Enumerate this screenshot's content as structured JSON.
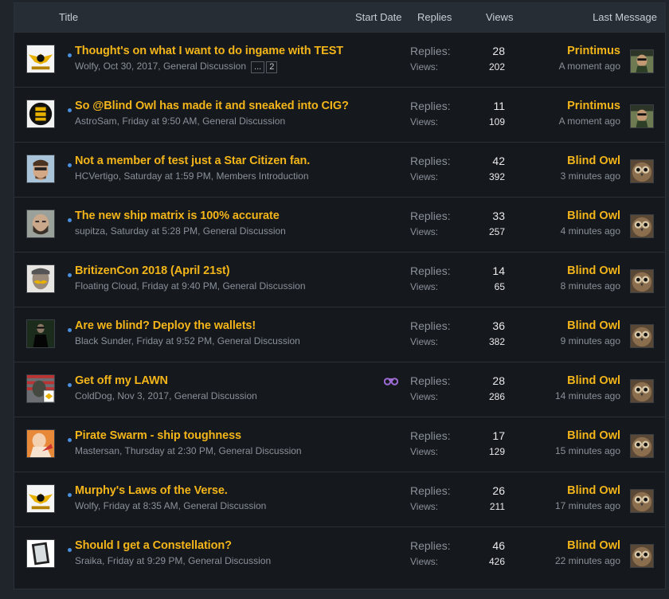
{
  "header": {
    "title": "Title",
    "start_date": "Start Date",
    "replies": "Replies",
    "views": "Views",
    "last_message": "Last Message"
  },
  "labels": {
    "replies": "Replies:",
    "views": "Views:"
  },
  "threads": [
    {
      "title": "Thought's on what I want to do ingame with TEST",
      "author": "Wolfy",
      "date": "Oct 30, 2017",
      "forum": "General Discussion",
      "pages": [
        "...",
        "2"
      ],
      "replies": "28",
      "views": "202",
      "last_user": "Printimus",
      "last_time": "A moment ago",
      "avatar": "wings-badge-icon",
      "last_avatar": "soldier-avatar-icon"
    },
    {
      "title": "So @Blind Owl has made it and sneaked into CIG?",
      "author": "AstroSam",
      "date": "Friday at 9:50 AM",
      "forum": "General Discussion",
      "replies": "11",
      "views": "109",
      "last_user": "Printimus",
      "last_time": "A moment ago",
      "avatar": "t-logo-icon",
      "last_avatar": "soldier-avatar-icon"
    },
    {
      "title": "Not a member of test just a Star Citizen fan.",
      "author": "HCVertigo",
      "date": "Saturday at 1:59 PM",
      "forum": "Members Introduction",
      "replies": "42",
      "views": "392",
      "last_user": "Blind Owl",
      "last_time": "3 minutes ago",
      "avatar": "face-avatar-icon",
      "last_avatar": "owl-avatar-icon"
    },
    {
      "title": "The new ship matrix is 100% accurate",
      "author": "supitza",
      "date": "Saturday at 5:28 PM",
      "forum": "General Discussion",
      "replies": "33",
      "views": "257",
      "last_user": "Blind Owl",
      "last_time": "4 minutes ago",
      "avatar": "bearded-face-icon",
      "last_avatar": "owl-avatar-icon"
    },
    {
      "title": "BritizenCon 2018 (April 21st)",
      "author": "Floating Cloud",
      "date": "Friday at 9:40 PM",
      "forum": "General Discussion",
      "replies": "14",
      "views": "65",
      "last_user": "Blind Owl",
      "last_time": "8 minutes ago",
      "avatar": "mustache-face-icon",
      "last_avatar": "owl-avatar-icon"
    },
    {
      "title": "Are we blind? Deploy the wallets!",
      "author": "Black Sunder",
      "date": "Friday at 9:52 PM",
      "forum": "General Discussion",
      "replies": "36",
      "views": "382",
      "last_user": "Blind Owl",
      "last_time": "9 minutes ago",
      "avatar": "matrix-figure-icon",
      "last_avatar": "owl-avatar-icon"
    },
    {
      "title": "Get off my LAWN",
      "author": "ColdDog",
      "date": "Nov 3, 2017",
      "forum": "General Discussion",
      "replies": "28",
      "views": "286",
      "last_user": "Blind Owl",
      "last_time": "14 minutes ago",
      "avatar": "flag-soldier-icon",
      "last_avatar": "owl-avatar-icon",
      "watched": true,
      "watch_icon": "binoculars-icon"
    },
    {
      "title": "Pirate Swarm - ship toughness",
      "author": "Mastersan",
      "date": "Thursday at 2:30 PM",
      "forum": "General Discussion",
      "replies": "17",
      "views": "129",
      "last_user": "Blind Owl",
      "last_time": "15 minutes ago",
      "avatar": "orange-figure-icon",
      "last_avatar": "owl-avatar-icon"
    },
    {
      "title": "Murphy's Laws of the Verse.",
      "author": "Wolfy",
      "date": "Friday at 8:35 AM",
      "forum": "General Discussion",
      "replies": "26",
      "views": "211",
      "last_user": "Blind Owl",
      "last_time": "17 minutes ago",
      "avatar": "wings-badge-icon",
      "last_avatar": "owl-avatar-icon"
    },
    {
      "title": "Should I get a Constellation?",
      "author": "Sraika",
      "date": "Friday at 9:29 PM",
      "forum": "General Discussion",
      "replies": "46",
      "views": "426",
      "last_user": "Blind Owl",
      "last_time": "22 minutes ago",
      "avatar": "frame-icon",
      "last_avatar": "owl-avatar-icon"
    }
  ],
  "colors": {
    "accent": "#f3b51a",
    "unread_dot": "#4a8fe0",
    "background": "#15181c",
    "header": "#262d35",
    "watch": "#9b6bd1"
  }
}
